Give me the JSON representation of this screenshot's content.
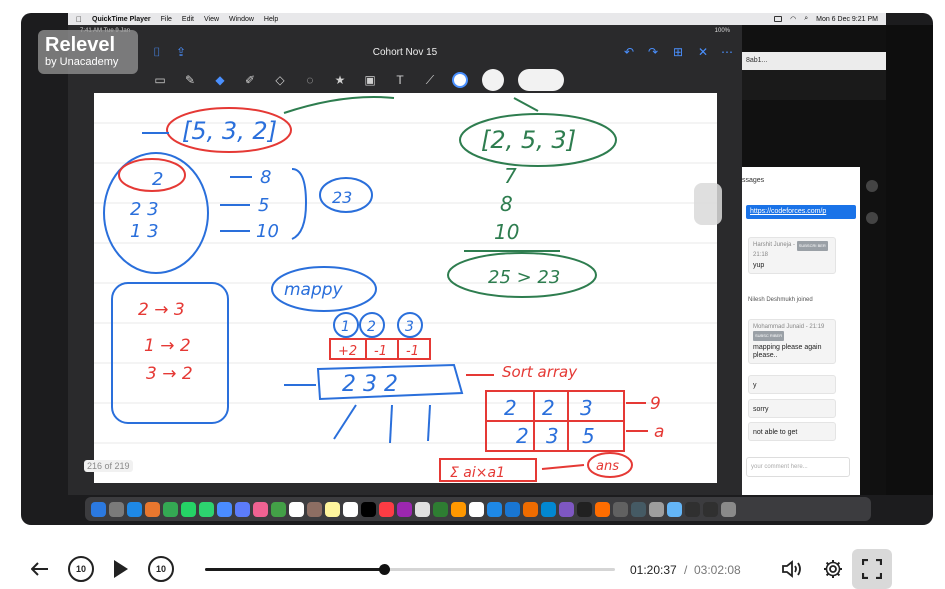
{
  "mac_menubar": {
    "app_name": "QuickTime Player",
    "menus": [
      "File",
      "Edit",
      "View",
      "Window",
      "Help"
    ],
    "clock": "Mon 6 Dec  9:21 PM"
  },
  "ipad": {
    "status_time": "7:41 AM  Tue 9 Jan",
    "status_battery": "100%",
    "note_title": "Cohort Nov 15",
    "page_counter": "216 of 219"
  },
  "logo": {
    "main": "Relevel",
    "sub": "by Unacademy"
  },
  "browser": {
    "tab_text": "8ab1...",
    "chat_title": "ssages",
    "link_text": "https://codeforces.com/p",
    "messages": [
      {
        "author": "Harshit Juneja -",
        "time": "21:18",
        "badge": "SUBSCRI BER",
        "text": "yup"
      },
      {
        "author": "Mohammad Junaid - 21:19",
        "badge": "SUBSC RIBER",
        "text": "mapping please again please.."
      },
      {
        "author": "",
        "text": "y"
      },
      {
        "author": "",
        "text": "sorry"
      },
      {
        "author": "",
        "text": "not able to get"
      }
    ],
    "system_note": "Nilesh Deshmukh joined",
    "comment_placeholder": "your comment here..."
  },
  "whiteboard": {
    "left_array": "[5, 3, 2]",
    "right_array": "[2, 5, 3]",
    "grid_rows": [
      "2",
      "2 3",
      "1 3"
    ],
    "arrow_values": [
      "8",
      "5",
      "10"
    ],
    "brace_value": "23",
    "mapping_label": "mappy",
    "map_rules": [
      "2 → 3",
      "1 → 2",
      "3 → 2"
    ],
    "right_column": [
      "7",
      "8",
      "10"
    ],
    "right_sum": "25 > 23",
    "circles": [
      "1",
      "2",
      "3"
    ],
    "delta_row": [
      "+2",
      "-1",
      "-1"
    ],
    "array_box": "2 3 2",
    "sort_label": "Sort array",
    "grid_row1": [
      "2",
      "2",
      "3"
    ],
    "grid_row2": [
      "2",
      "3",
      "5"
    ],
    "grid_outputs": [
      "9",
      "a"
    ],
    "sum_label": "Σ ai×a1",
    "ans_label": "ans"
  },
  "controls": {
    "current_time": "01:20:37",
    "separator": "/",
    "duration": "03:02:08",
    "progress": 0.436,
    "skip_back_label": "10",
    "skip_forward_label": "10"
  },
  "colors": {
    "ink_blue": "#2a6fdb",
    "ink_red": "#e53935",
    "ink_green": "#2e7d4f",
    "accent": "#4a90ff"
  }
}
